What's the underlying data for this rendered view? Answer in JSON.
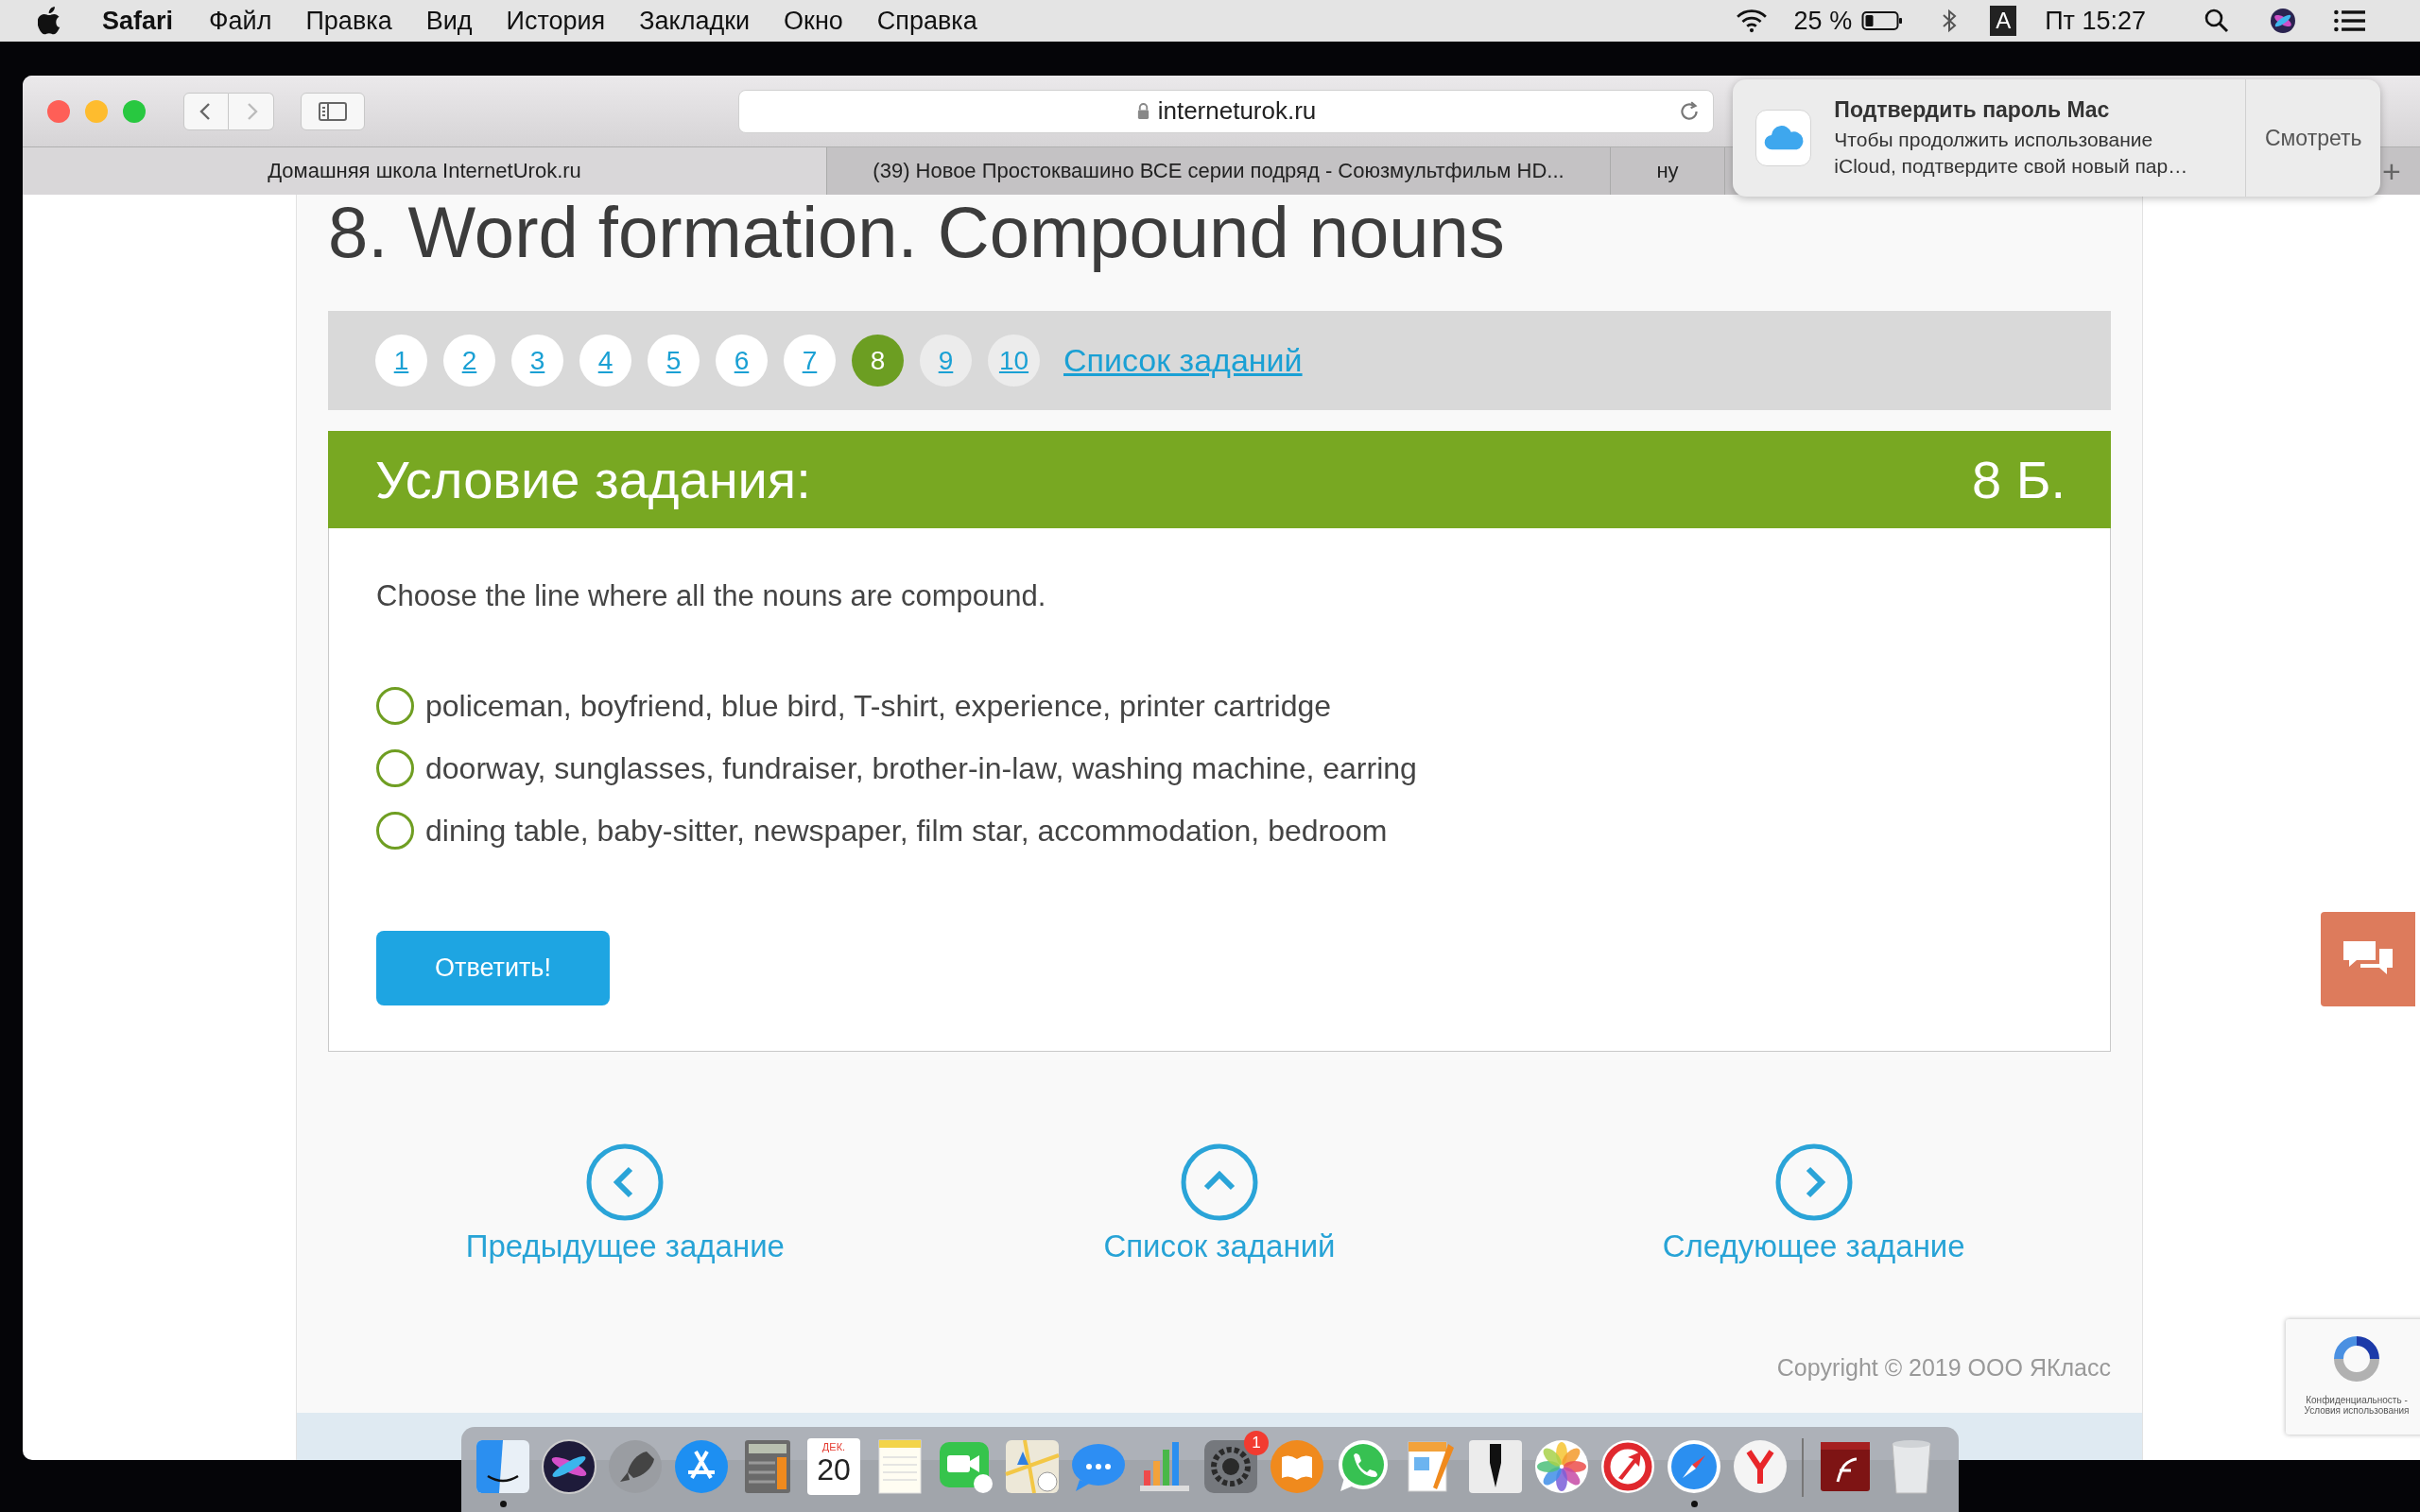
{
  "menu_bar": {
    "app": "Safari",
    "items": [
      "Файл",
      "Правка",
      "Вид",
      "История",
      "Закладки",
      "Окно",
      "Справка"
    ],
    "battery": "25 %",
    "input_source": "A",
    "clock": "Пт 15:27"
  },
  "browser": {
    "address": "interneturok.ru",
    "tabs": [
      {
        "title": "Домашняя школа InternetUrok.ru",
        "selected": true
      },
      {
        "title": "(39) Новое Простоквашино ВСЕ серии подряд - Союзмультфильм HD...",
        "selected": false
      },
      {
        "title": "ну",
        "selected": false
      }
    ],
    "new_tab": "+"
  },
  "page": {
    "title": "8. Word formation. Compound nouns",
    "pages": [
      {
        "label": "1",
        "selected": false,
        "done": true
      },
      {
        "label": "2",
        "selected": false,
        "done": true
      },
      {
        "label": "3",
        "selected": false,
        "done": true
      },
      {
        "label": "4",
        "selected": false,
        "done": true
      },
      {
        "label": "5",
        "selected": false,
        "done": true
      },
      {
        "label": "6",
        "selected": false,
        "done": true
      },
      {
        "label": "7",
        "selected": false,
        "done": true
      },
      {
        "label": "8",
        "selected": true,
        "done": false
      },
      {
        "label": "9",
        "selected": false,
        "done": false
      },
      {
        "label": "10",
        "selected": false,
        "done": false
      }
    ],
    "task_list_link": "Список заданий",
    "task": {
      "heading": "Условие задания:",
      "points": "8 Б.",
      "question": "Choose the line where all the nouns are compound.",
      "options": [
        {
          "text": "policeman, boyfriend, blue bird, T-shirt, experience, printer cartridge",
          "selected": false
        },
        {
          "text": "doorway, sunglasses, fundraiser, brother-in-law, washing machine, earring",
          "selected": false
        },
        {
          "text": "dining table, baby-sitter, newspaper, film star, accommodation, bedroom",
          "selected": false
        }
      ],
      "submit": "Ответить!"
    },
    "nav": [
      {
        "kind": "prev",
        "label": "Предыдущее задание"
      },
      {
        "kind": "up",
        "label": "Список заданий"
      },
      {
        "kind": "next",
        "label": "Следующее задание"
      }
    ],
    "copyright": "Copyright © 2019 ООО ЯКласс"
  },
  "notification": {
    "title": "Подтвердить пароль Mac",
    "body": [
      "Чтобы продолжить использование",
      "iCloud, подтвердите свой новый пар…"
    ],
    "action": "Смотреть"
  },
  "recaptcha": {
    "lines": [
      "Конфиденциальность -",
      "Условия использования"
    ]
  },
  "dock": {
    "items": [
      {
        "kind": "finder",
        "running": true
      },
      {
        "kind": "siri",
        "running": false
      },
      {
        "kind": "launchpad",
        "running": false
      },
      {
        "kind": "appstore",
        "running": false
      },
      {
        "kind": "calculator",
        "running": false
      },
      {
        "kind": "calendar",
        "running": false,
        "month": "ДЕК.",
        "day": "20"
      },
      {
        "kind": "notes",
        "running": false
      },
      {
        "kind": "facetime",
        "running": false
      },
      {
        "kind": "maps",
        "running": false
      },
      {
        "kind": "messages",
        "running": false
      },
      {
        "kind": "numbers",
        "running": false
      },
      {
        "kind": "settings",
        "running": false,
        "badge": "1"
      },
      {
        "kind": "books",
        "running": false
      },
      {
        "kind": "whatsapp",
        "running": false
      },
      {
        "kind": "pages",
        "running": false
      },
      {
        "kind": "pen",
        "running": false
      },
      {
        "kind": "photos",
        "running": false
      },
      {
        "kind": "arrow",
        "running": false
      },
      {
        "kind": "safari",
        "running": true
      },
      {
        "kind": "yandex",
        "running": false
      },
      {
        "kind": "separator",
        "running": false
      },
      {
        "kind": "flash",
        "running": false
      },
      {
        "kind": "trash",
        "running": false
      }
    ]
  }
}
